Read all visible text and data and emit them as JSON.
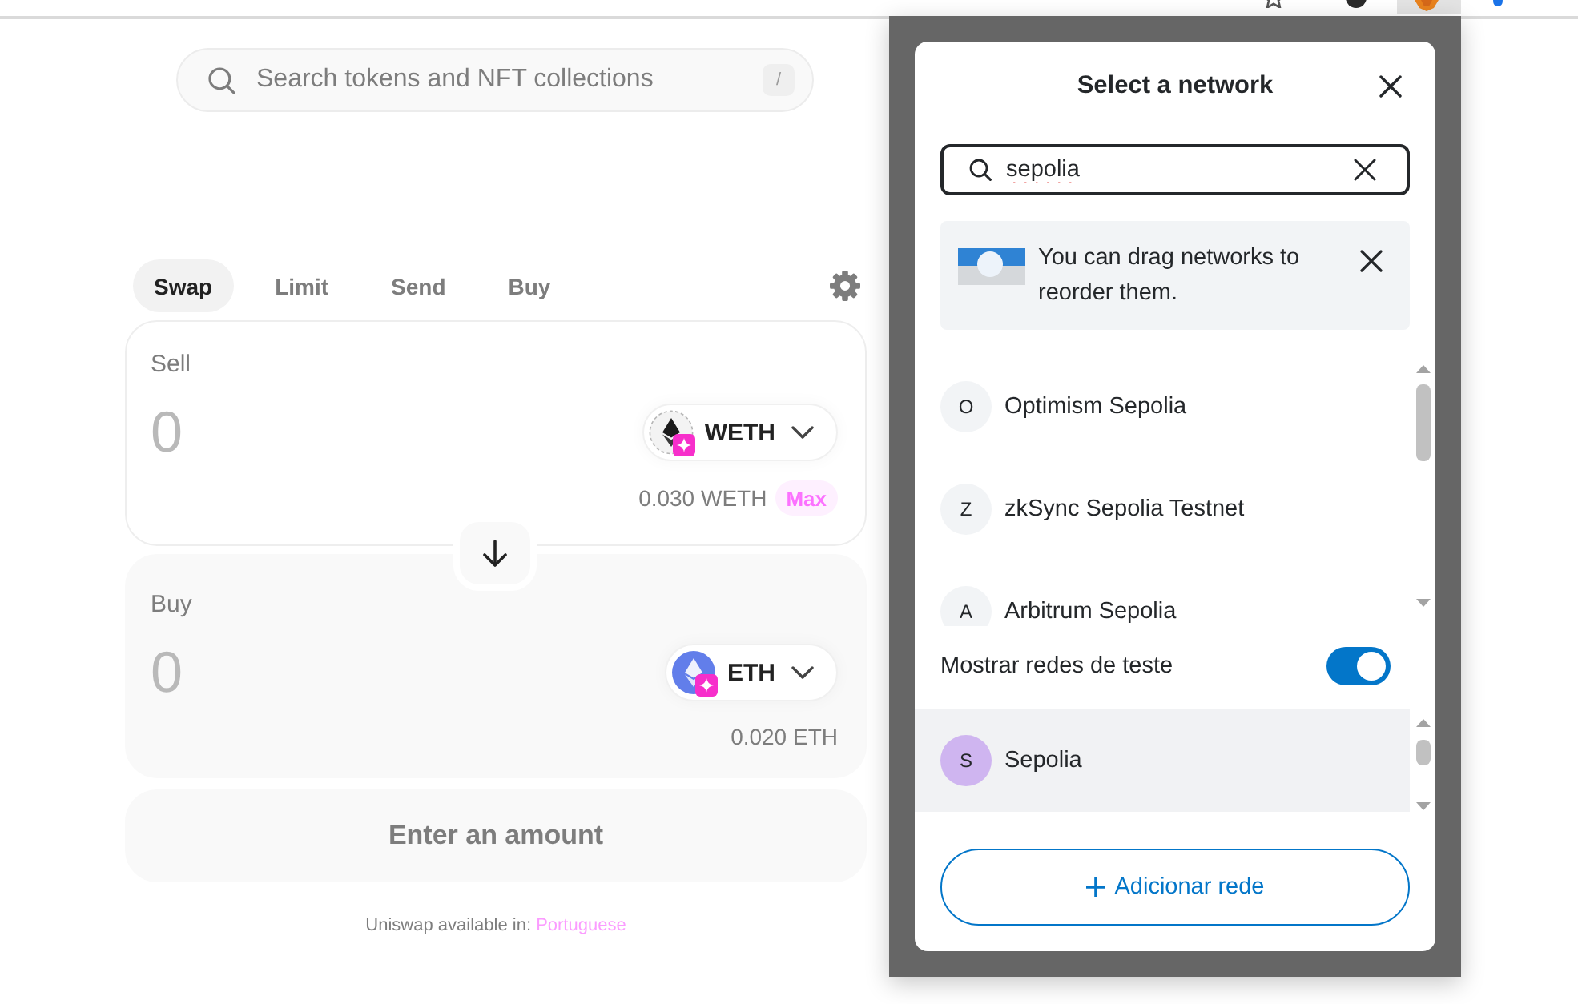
{
  "search": {
    "placeholder": "Search tokens and NFT collections",
    "shortcut": "/"
  },
  "tabs": [
    {
      "label": "Swap",
      "selected": true
    },
    {
      "label": "Limit",
      "selected": false
    },
    {
      "label": "Send",
      "selected": false
    },
    {
      "label": "Buy",
      "selected": false
    }
  ],
  "sell": {
    "label": "Sell",
    "amount": {
      "placeholder": "0"
    },
    "token": {
      "symbol": "WETH",
      "kind": "wrapped"
    },
    "balance": "0.030 WETH",
    "max": "Max"
  },
  "buy": {
    "label": "Buy",
    "amount": {
      "placeholder": "0"
    },
    "token": {
      "symbol": "ETH",
      "kind": "native"
    },
    "balance": "0.020 ETH"
  },
  "submit_button": {
    "label": "Enter an amount",
    "disabled": true
  },
  "footer": {
    "text": "Uniswap available in:",
    "link": "Portuguese"
  },
  "network_dialog": {
    "title": "Select a network",
    "search": {
      "value": "sepolia"
    },
    "notice": "You can drag networks to reorder them.",
    "networks": [
      {
        "initial": "O",
        "name": "Optimism Sepolia",
        "color": "#f2f4f6",
        "highlighted": false
      },
      {
        "initial": "Z",
        "name": "zkSync Sepolia Testnet",
        "color": "#f2f4f6",
        "highlighted": false
      },
      {
        "initial": "A",
        "name": "Arbitrum Sepolia",
        "color": "#f2f4f6",
        "highlighted": false
      }
    ],
    "show_test_networks": {
      "label": "Mostrar redes de teste",
      "on": true
    },
    "test_networks": [
      {
        "initial": "S",
        "name": "Sepolia",
        "color": "#cfb5f0",
        "highlighted": true
      }
    ],
    "add_button": "Adicionar rede"
  }
}
